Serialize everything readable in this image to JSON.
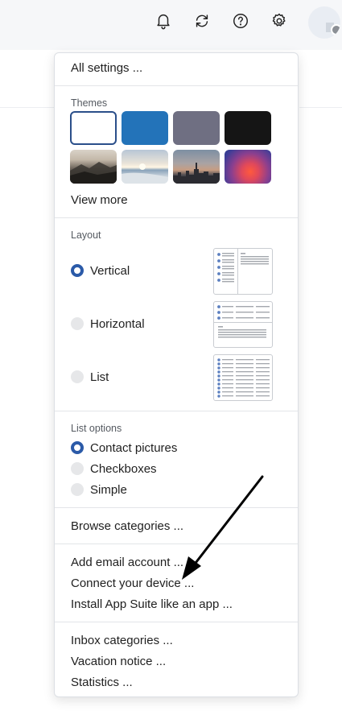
{
  "topbar": {
    "icons": [
      "bell-icon",
      "refresh-icon",
      "help-icon",
      "gear-icon"
    ],
    "background": "#f6f7f9"
  },
  "menu": {
    "all_settings": "All settings ...",
    "themes": {
      "title": "Themes",
      "swatches": [
        {
          "name": "white",
          "color": "#ffffff",
          "selected": true
        },
        {
          "name": "blue",
          "color": "#2373b9"
        },
        {
          "name": "gray",
          "color": "#6f6f82"
        },
        {
          "name": "black",
          "color": "#151515"
        },
        {
          "name": "mountains",
          "kind": "image"
        },
        {
          "name": "beach",
          "kind": "image"
        },
        {
          "name": "city",
          "kind": "image"
        },
        {
          "name": "glow",
          "kind": "image"
        }
      ],
      "view_more": "View more"
    },
    "layout": {
      "title": "Layout",
      "options": [
        {
          "label": "Vertical",
          "selected": true
        },
        {
          "label": "Horizontal",
          "selected": false
        },
        {
          "label": "List",
          "selected": false
        }
      ]
    },
    "list_options": {
      "title": "List options",
      "options": [
        {
          "label": "Contact pictures",
          "selected": true
        },
        {
          "label": "Checkboxes",
          "selected": false
        },
        {
          "label": "Simple",
          "selected": false
        }
      ]
    },
    "browse_categories": "Browse categories ...",
    "add_email_account": "Add email account ...",
    "connect_device": "Connect your device ...",
    "install_app": "Install App Suite like an app ...",
    "inbox_categories": "Inbox categories ...",
    "vacation_notice": "Vacation notice ...",
    "statistics": "Statistics ..."
  },
  "colors": {
    "accent": "#2b5aa8",
    "separator": "#e3e5e8",
    "preview_dot": "#5b7fc0"
  }
}
